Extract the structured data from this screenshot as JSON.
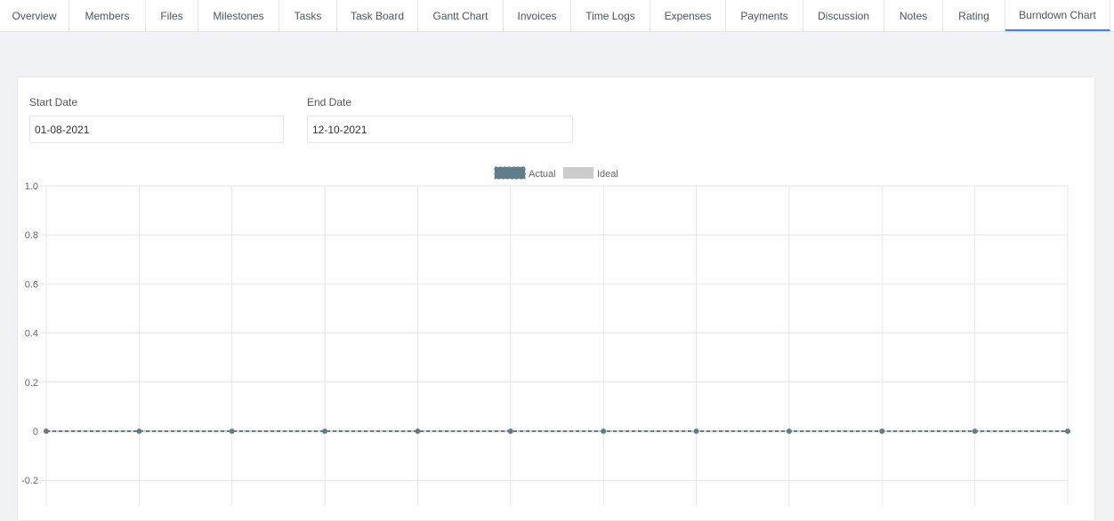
{
  "tabs": [
    {
      "label": "Overview",
      "active": false
    },
    {
      "label": "Members",
      "active": false
    },
    {
      "label": "Files",
      "active": false
    },
    {
      "label": "Milestones",
      "active": false
    },
    {
      "label": "Tasks",
      "active": false
    },
    {
      "label": "Task Board",
      "active": false
    },
    {
      "label": "Gantt Chart",
      "active": false
    },
    {
      "label": "Invoices",
      "active": false
    },
    {
      "label": "Time Logs",
      "active": false
    },
    {
      "label": "Expenses",
      "active": false
    },
    {
      "label": "Payments",
      "active": false
    },
    {
      "label": "Discussion",
      "active": false
    },
    {
      "label": "Notes",
      "active": false
    },
    {
      "label": "Rating",
      "active": false
    },
    {
      "label": "Burndown Chart",
      "active": true
    }
  ],
  "filters": {
    "start_date_label": "Start Date",
    "start_date_value": "01-08-2021",
    "end_date_label": "End Date",
    "end_date_value": "12-10-2021"
  },
  "colors": {
    "accent": "#3b82f6",
    "actual_series": "#607d8b",
    "ideal_series": "#cccccc"
  },
  "chart_data": {
    "type": "line",
    "legend": [
      {
        "name": "Actual",
        "color": "#607d8b"
      },
      {
        "name": "Ideal",
        "color": "#cccccc"
      }
    ],
    "legend_position": "top-center",
    "y_ticks": [
      "1.0",
      "0.8",
      "0.6",
      "0.4",
      "0.2",
      "0",
      "-0.2"
    ],
    "ylim": [
      -0.2,
      1.0
    ],
    "grid": true,
    "series": [
      {
        "name": "Actual",
        "values": [
          0,
          0,
          0,
          0,
          0,
          0,
          0,
          0,
          0,
          0,
          0,
          0
        ]
      },
      {
        "name": "Ideal",
        "values": [
          0,
          0,
          0,
          0,
          0,
          0,
          0,
          0,
          0,
          0,
          0,
          0
        ]
      }
    ]
  }
}
